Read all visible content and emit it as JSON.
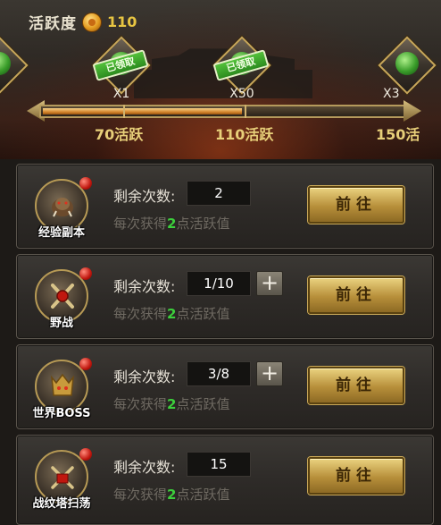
{
  "activity": {
    "label": "活跃度",
    "value": "110"
  },
  "rewards": [
    {
      "badge": "已领取",
      "qty": "X1"
    },
    {
      "badge": "已领取",
      "qty": "X50"
    },
    {
      "badge": "",
      "qty": "X3"
    }
  ],
  "progress": {
    "fraction": 0.55
  },
  "milestones": [
    "70活跃",
    "110活跃",
    "150活"
  ],
  "tasks": [
    {
      "name": "经验副本",
      "remain_label": "剩余次数:",
      "remain": "2",
      "desc_prefix": "每次获得",
      "desc_points": "2",
      "desc_suffix": "点活跃值",
      "button": "前往",
      "has_plus": false
    },
    {
      "name": "野战",
      "remain_label": "剩余次数:",
      "remain": "1/10",
      "desc_prefix": "每次获得",
      "desc_points": "2",
      "desc_suffix": "点活跃值",
      "button": "前往",
      "has_plus": true,
      "plus": "+"
    },
    {
      "name": "世界BOSS",
      "remain_label": "剩余次数:",
      "remain": "3/8",
      "desc_prefix": "每次获得",
      "desc_points": "2",
      "desc_suffix": "点活跃值",
      "button": "前往",
      "has_plus": true,
      "plus": "+"
    },
    {
      "name": "战纹塔扫荡",
      "remain_label": "剩余次数:",
      "remain": "15",
      "desc_prefix": "每次获得",
      "desc_points": "2",
      "desc_suffix": "点活跃值",
      "button": "前往",
      "has_plus": false
    }
  ],
  "colors": {
    "accent_gold": "#e8c542",
    "points_green": "#3ccf3c",
    "claimed_green": "#2c8c1f"
  },
  "icons": [
    "coin-icon",
    "reward-chest-icon",
    "boar-icon",
    "crossed-swords-icon",
    "boss-helmet-icon",
    "tower-sweep-icon",
    "plus-icon"
  ]
}
